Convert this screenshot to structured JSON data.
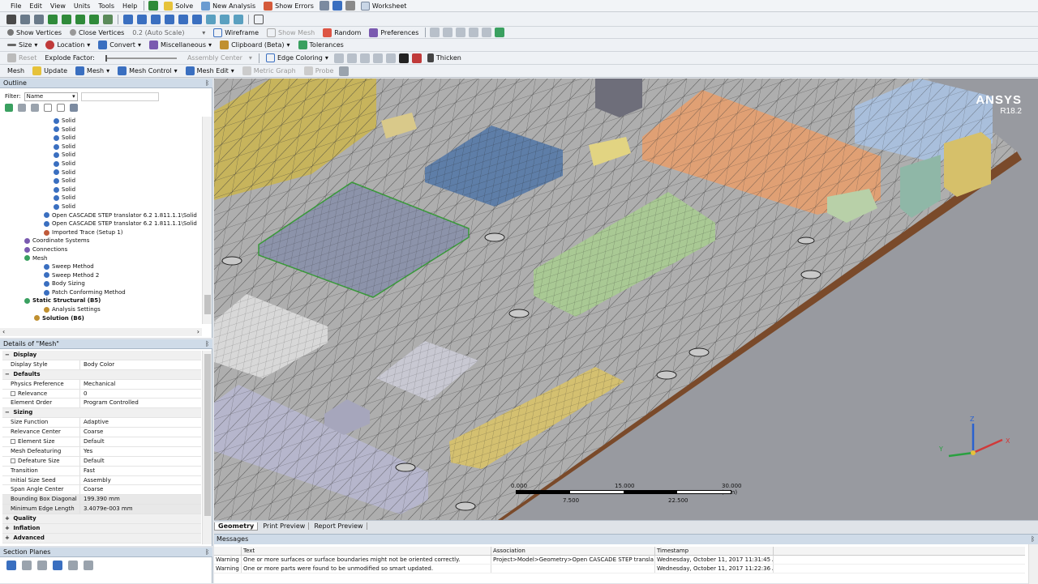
{
  "menu": [
    "File",
    "Edit",
    "View",
    "Units",
    "Tools",
    "Help"
  ],
  "toolbar1": {
    "solve": "Solve",
    "new_analysis": "New Analysis",
    "show_errors": "Show Errors",
    "worksheet": "Worksheet"
  },
  "toolbar2": {
    "show_vertices": "Show Vertices",
    "close_vertices": "Close Vertices",
    "auto_scale": "0.2 (Auto Scale)",
    "wireframe": "Wireframe",
    "show_mesh": "Show Mesh",
    "random": "Random",
    "preferences": "Preferences"
  },
  "toolbar3": {
    "size": "Size",
    "location": "Location",
    "convert": "Convert",
    "miscellaneous": "Miscellaneous",
    "clipboard": "Clipboard (Beta)",
    "tolerances": "Tolerances"
  },
  "toolbar4": {
    "reset": "Reset",
    "explode_factor": "Explode Factor:",
    "assembly_center": "Assembly Center",
    "edge_coloring": "Edge Coloring",
    "thicken": "Thicken"
  },
  "toolbar5": {
    "mesh": "Mesh",
    "update": "Update",
    "mesh_menu": "Mesh",
    "mesh_control": "Mesh Control",
    "mesh_edit": "Mesh Edit",
    "metric_graph": "Metric Graph",
    "probe": "Probe"
  },
  "outline": {
    "title": "Outline",
    "filter_label": "Filter:",
    "filter_value": "Name",
    "items": [
      {
        "label": "Solid",
        "indent": 5,
        "color": "#3a6fc0"
      },
      {
        "label": "Solid",
        "indent": 5,
        "color": "#3a6fc0"
      },
      {
        "label": "Solid",
        "indent": 5,
        "color": "#3a6fc0"
      },
      {
        "label": "Solid",
        "indent": 5,
        "color": "#3a6fc0"
      },
      {
        "label": "Solid",
        "indent": 5,
        "color": "#3a6fc0"
      },
      {
        "label": "Solid",
        "indent": 5,
        "color": "#3a6fc0"
      },
      {
        "label": "Solid",
        "indent": 5,
        "color": "#3a6fc0"
      },
      {
        "label": "Solid",
        "indent": 5,
        "color": "#3a6fc0"
      },
      {
        "label": "Solid",
        "indent": 5,
        "color": "#3a6fc0"
      },
      {
        "label": "Solid",
        "indent": 5,
        "color": "#3a6fc0"
      },
      {
        "label": "Solid",
        "indent": 5,
        "color": "#3a6fc0"
      },
      {
        "label": "Open CASCADE STEP translator 6.2 1.811.1.1\\Solid",
        "indent": 4,
        "color": "#3a6fc0"
      },
      {
        "label": "Open CASCADE STEP translator 6.2 1.811.1.1\\Solid",
        "indent": 4,
        "color": "#3a6fc0"
      },
      {
        "label": "Imported Trace (Setup 1)",
        "indent": 4,
        "color": "#c05a3a"
      },
      {
        "label": "Coordinate Systems",
        "indent": 2,
        "color": "#7a5ab0"
      },
      {
        "label": "Connections",
        "indent": 2,
        "color": "#7a5ab0"
      },
      {
        "label": "Mesh",
        "indent": 2,
        "color": "#3aa060"
      },
      {
        "label": "Sweep Method",
        "indent": 4,
        "color": "#3a6fc0"
      },
      {
        "label": "Sweep Method 2",
        "indent": 4,
        "color": "#3a6fc0"
      },
      {
        "label": "Body Sizing",
        "indent": 4,
        "color": "#3a6fc0"
      },
      {
        "label": "Patch Conforming Method",
        "indent": 4,
        "color": "#3a6fc0"
      },
      {
        "label": "Static Structural (B5)",
        "indent": 2,
        "color": "#3aa060",
        "bold": true
      },
      {
        "label": "Analysis Settings",
        "indent": 4,
        "color": "#c09030"
      },
      {
        "label": "Solution (B6)",
        "indent": 3,
        "color": "#c09030",
        "bold": true
      }
    ]
  },
  "details": {
    "title": "Details of \"Mesh\"",
    "rows": [
      {
        "k": "Display",
        "v": "",
        "grp": true
      },
      {
        "k": "Display Style",
        "v": "Body Color"
      },
      {
        "k": "Defaults",
        "v": "",
        "grp": true
      },
      {
        "k": "Physics Preference",
        "v": "Mechanical"
      },
      {
        "k": "Relevance",
        "v": "0",
        "cb": true
      },
      {
        "k": "Element Order",
        "v": "Program Controlled"
      },
      {
        "k": "Sizing",
        "v": "",
        "grp": true
      },
      {
        "k": "Size Function",
        "v": "Adaptive"
      },
      {
        "k": "Relevance Center",
        "v": "Coarse"
      },
      {
        "k": "Element Size",
        "v": "Default",
        "cb": true
      },
      {
        "k": "Mesh Defeaturing",
        "v": "Yes"
      },
      {
        "k": "Defeature Size",
        "v": "Default",
        "cb": true
      },
      {
        "k": "Transition",
        "v": "Fast"
      },
      {
        "k": "Initial Size Seed",
        "v": "Assembly"
      },
      {
        "k": "Span Angle Center",
        "v": "Coarse"
      },
      {
        "k": "Bounding Box Diagonal",
        "v": "199.390 mm",
        "gray": true
      },
      {
        "k": "Minimum Edge Length",
        "v": "3.4079e-003 mm",
        "gray": true
      },
      {
        "k": "Quality",
        "v": "",
        "grp": true
      },
      {
        "k": "Inflation",
        "v": "",
        "grp": true
      },
      {
        "k": "Advanced",
        "v": "",
        "grp": true
      }
    ]
  },
  "section_planes": {
    "title": "Section Planes"
  },
  "viewport": {
    "brand": "ANSYS",
    "version": "R18.2",
    "scale_labels_top": [
      "0.000",
      "15.000",
      "30.000 (mm)"
    ],
    "scale_labels_bottom": [
      "7.500",
      "22.500"
    ],
    "axes": {
      "x": "X",
      "y": "Y",
      "z": "Z"
    }
  },
  "tabs": [
    "Geometry",
    "Print Preview",
    "Report Preview"
  ],
  "messages": {
    "title": "Messages",
    "columns": [
      "Text",
      "Association",
      "Timestamp"
    ],
    "rows": [
      {
        "type": "Warning",
        "text": "One or more surfaces or surface boundaries might not be oriented correctly.",
        "assoc": "Project>Model>Geometry>Open CASCADE STEP transla",
        "time": "Wednesday, October 11, 2017 11:31:45 AI"
      },
      {
        "type": "Warning",
        "text": "One or more parts were found to be unmodified so smart updated.",
        "assoc": "",
        "time": "Wednesday, October 11, 2017 11:22:36 AI"
      }
    ]
  }
}
